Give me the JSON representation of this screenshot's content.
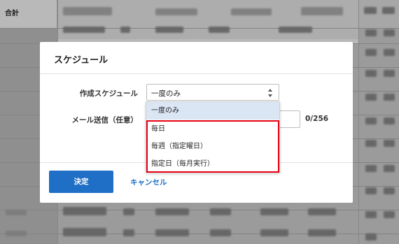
{
  "background": {
    "total_header": "合計"
  },
  "modal": {
    "title": "スケジュール",
    "schedule_label": "作成スケジュール",
    "schedule_value": "一度のみ",
    "mail_label": "メール送信（任意）",
    "mail_value": "",
    "char_count": "0/256",
    "confirm_label": "決定",
    "cancel_label": "キャンセル"
  },
  "dropdown": {
    "options": [
      {
        "label": "一度のみ",
        "selected": true
      },
      {
        "label": "毎日",
        "selected": false
      },
      {
        "label": "毎週（指定曜日）",
        "selected": false
      },
      {
        "label": "指定日（毎月実行）",
        "selected": false
      }
    ]
  },
  "colors": {
    "primary": "#1f6fc6",
    "highlight": "#e60012",
    "selected_option": "#dbe6f5"
  }
}
